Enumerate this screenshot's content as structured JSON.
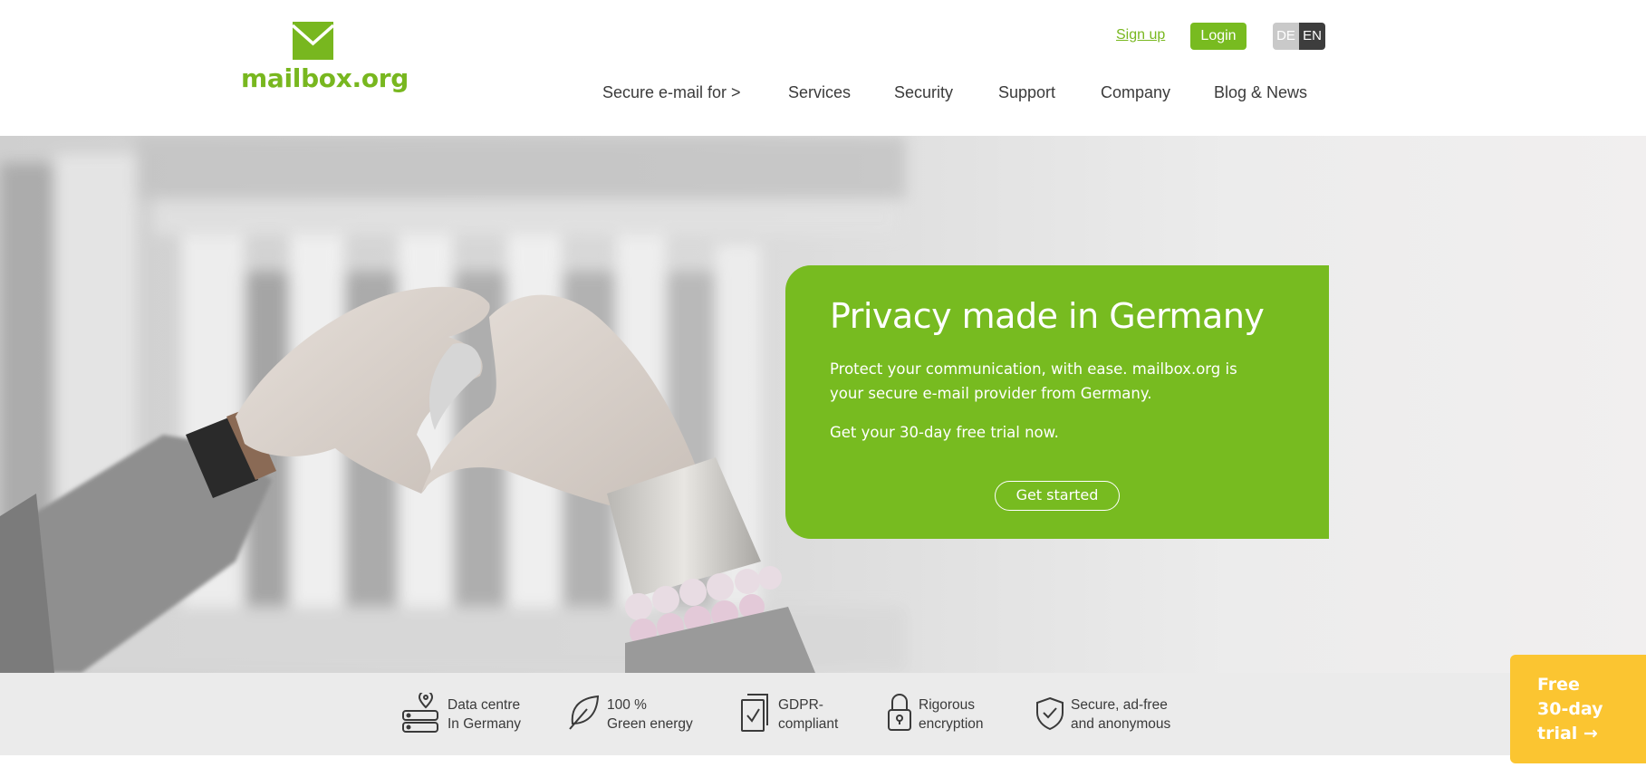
{
  "brand": {
    "name": "mailbox.org",
    "color": "#78b71f"
  },
  "header": {
    "signup_label": "Sign up",
    "login_label": "Login",
    "lang": {
      "de": "DE",
      "en": "EN",
      "active": "EN"
    }
  },
  "nav": {
    "items": [
      {
        "label": "Secure e-mail for >"
      },
      {
        "label": "Services"
      },
      {
        "label": "Security"
      },
      {
        "label": "Support"
      },
      {
        "label": "Company"
      },
      {
        "label": "Blog & News"
      }
    ]
  },
  "hero": {
    "title": "Privacy made in Germany",
    "description": "Protect your communication, with ease. mailbox.org is your secure e-mail provider from Germany.",
    "trial_text": "Get your 30-day free trial now.",
    "cta_label": "Get started",
    "panel_color": "#77bb20"
  },
  "features": [
    {
      "line1": "Data centre",
      "line2": "In Germany",
      "icon": "server-location-icon"
    },
    {
      "line1": "100 %",
      "line2": "Green energy",
      "icon": "leaf-icon"
    },
    {
      "line1": "GDPR-",
      "line2": "compliant",
      "icon": "document-check-icon"
    },
    {
      "line1": "Rigorous",
      "line2": "encryption",
      "icon": "lock-icon"
    },
    {
      "line1": "Secure, ad-free",
      "line2": "and anonymous",
      "icon": "shield-check-icon"
    }
  ],
  "trial_badge": {
    "line1": "Free",
    "line2": "30-day",
    "line3": "trial →",
    "color": "#fbc531"
  }
}
